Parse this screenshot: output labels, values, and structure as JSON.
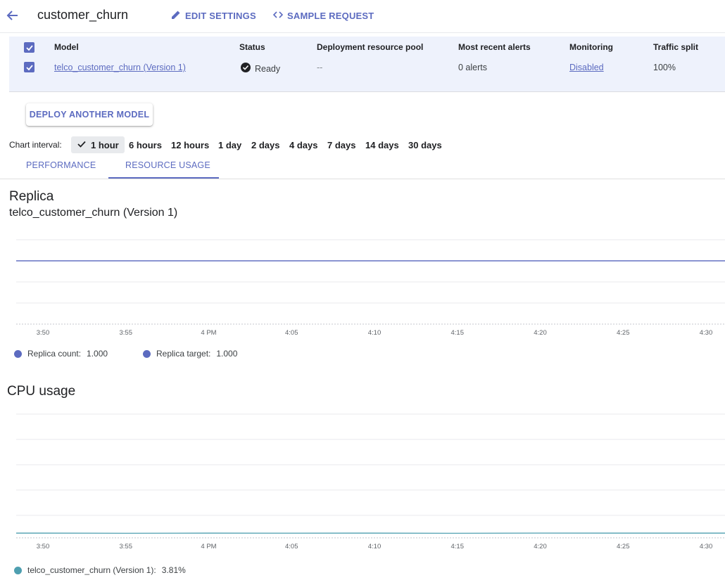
{
  "header": {
    "title": "customer_churn",
    "edit_settings_label": "EDIT SETTINGS",
    "sample_request_label": "SAMPLE REQUEST"
  },
  "table": {
    "columns": [
      "Model",
      "Status",
      "Deployment resource pool",
      "Most recent alerts",
      "Monitoring",
      "Traffic split"
    ],
    "rows": [
      {
        "model": "telco_customer_churn (Version 1)",
        "status": "Ready",
        "pool": "--",
        "alerts": "0 alerts",
        "monitoring": "Disabled",
        "traffic": "100%"
      }
    ]
  },
  "deploy_button_label": "DEPLOY ANOTHER MODEL",
  "interval": {
    "label": "Chart interval:",
    "options": [
      "1 hour",
      "6 hours",
      "12 hours",
      "1 day",
      "2 days",
      "4 days",
      "7 days",
      "14 days",
      "30 days"
    ],
    "selected": "1 hour"
  },
  "tabs": [
    {
      "label": "PERFORMANCE",
      "active": false
    },
    {
      "label": "RESOURCE USAGE",
      "active": true
    }
  ],
  "replica": {
    "title": "Replica",
    "subtitle": "telco_customer_churn (Version 1)",
    "legend": [
      {
        "label": "Replica count:",
        "value": "1.000",
        "color": "#5c6bc0"
      },
      {
        "label": "Replica target:",
        "value": "1.000",
        "color": "#5c6bc0"
      }
    ]
  },
  "cpu": {
    "title": "CPU usage",
    "legend": [
      {
        "label": "telco_customer_churn (Version 1):",
        "value": "3.81%",
        "color": "#4e9fb0"
      }
    ]
  },
  "colors": {
    "accent": "#5c6bc0",
    "table_bg": "#eef2fc",
    "cpu_line": "#4e9fb0"
  },
  "chart_data": [
    {
      "type": "line",
      "x": [
        "3:50",
        "3:55",
        "4 PM",
        "4:05",
        "4:10",
        "4:15",
        "4:20",
        "4:25",
        "4:30"
      ],
      "series": [
        {
          "name": "Replica count",
          "values": [
            1,
            1,
            1,
            1,
            1,
            1,
            1,
            1,
            1
          ]
        },
        {
          "name": "Replica target",
          "values": [
            1,
            1,
            1,
            1,
            1,
            1,
            1,
            1,
            1
          ]
        }
      ]
    },
    {
      "type": "line",
      "x": [
        "3:50",
        "3:55",
        "4 PM",
        "4:05",
        "4:10",
        "4:15",
        "4:20",
        "4:25",
        "4:30"
      ],
      "series": [
        {
          "name": "telco_customer_churn (Version 1)",
          "values": [
            3.8,
            3.7,
            3.8,
            3.75,
            3.8,
            3.7,
            3.85,
            3.8,
            3.81
          ]
        }
      ]
    }
  ]
}
